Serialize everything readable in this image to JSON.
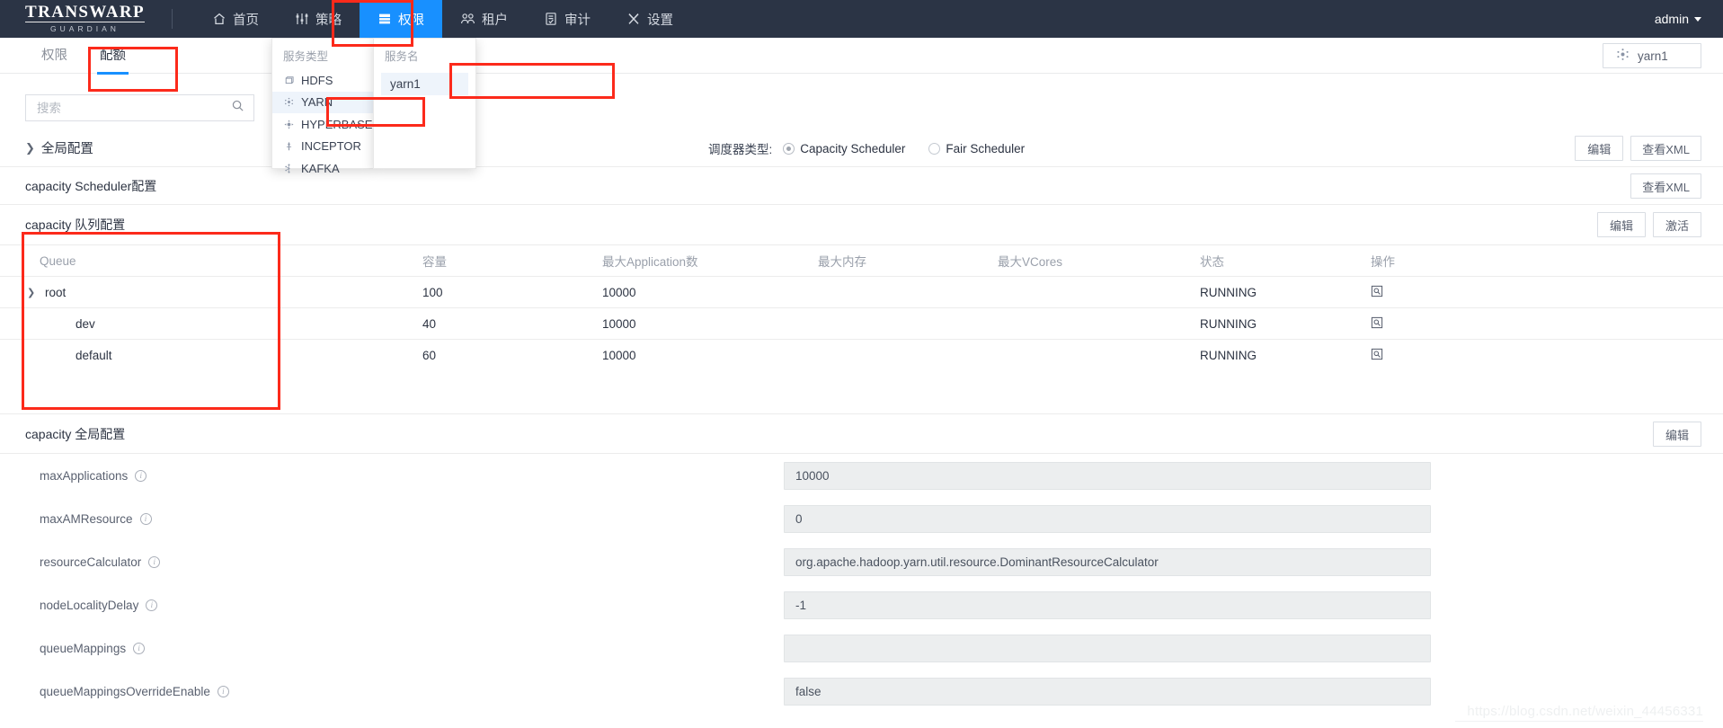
{
  "brand": {
    "main": "TRANSWARP",
    "sub": "GUARDIAN"
  },
  "navbar": {
    "items": [
      {
        "label": "首页",
        "icon": "home-icon",
        "active": false
      },
      {
        "label": "策略",
        "icon": "sliders-icon",
        "active": false
      },
      {
        "label": "权限",
        "icon": "permissions-icon",
        "active": true
      },
      {
        "label": "租户",
        "icon": "tenant-icon",
        "active": false
      },
      {
        "label": "审计",
        "icon": "audit-icon",
        "active": false
      },
      {
        "label": "设置",
        "icon": "gear-icon",
        "active": false
      }
    ],
    "user": "admin"
  },
  "service_dropdown": {
    "type_header": "服务类型",
    "name_header": "服务名",
    "types": [
      {
        "label": "HDFS",
        "icon": "hdfs-icon",
        "selected": false
      },
      {
        "label": "YARN",
        "icon": "yarn-icon",
        "selected": true
      },
      {
        "label": "HYPERBASE",
        "icon": "hyperbase-icon",
        "selected": false
      },
      {
        "label": "INCEPTOR",
        "icon": "inceptor-icon",
        "selected": false
      },
      {
        "label": "KAFKA",
        "icon": "kafka-icon",
        "selected": false
      }
    ],
    "names": [
      {
        "label": "yarn1",
        "selected": true
      }
    ]
  },
  "tabs": [
    {
      "label": "权限",
      "active": false
    },
    {
      "label": "配额",
      "active": true
    }
  ],
  "service_chip": {
    "label": "yarn1",
    "icon": "yarn-icon"
  },
  "search": {
    "placeholder": "搜索",
    "value": ""
  },
  "global_section": {
    "title": "全局配置",
    "scheduler_label": "调度器类型:",
    "scheduler_options": [
      {
        "label": "Capacity Scheduler",
        "selected": true
      },
      {
        "label": "Fair Scheduler",
        "selected": false
      }
    ],
    "edit_label": "编辑",
    "xml_label": "查看XML"
  },
  "scheduler_section": {
    "title": "capacity Scheduler配置",
    "xml_label": "查看XML"
  },
  "queue_section": {
    "title": "capacity 队列配置",
    "edit_label": "编辑",
    "activate_label": "激活",
    "columns": [
      "Queue",
      "容量",
      "最大Application数",
      "最大内存",
      "最大VCores",
      "状态",
      "操作"
    ],
    "rows": [
      {
        "queue": "root",
        "indent": 0,
        "expandable": true,
        "capacity": "100",
        "max_applications": "10000",
        "max_memory": "",
        "max_vcores": "",
        "status": "RUNNING",
        "action_icon": "view-detail-icon"
      },
      {
        "queue": "dev",
        "indent": 1,
        "expandable": false,
        "capacity": "40",
        "max_applications": "10000",
        "max_memory": "",
        "max_vcores": "",
        "status": "RUNNING",
        "action_icon": "view-detail-icon"
      },
      {
        "queue": "default",
        "indent": 1,
        "expandable": false,
        "capacity": "60",
        "max_applications": "10000",
        "max_memory": "",
        "max_vcores": "",
        "status": "RUNNING",
        "action_icon": "view-detail-icon"
      }
    ]
  },
  "capacity_global": {
    "title": "capacity 全局配置",
    "edit_label": "编辑",
    "fields": [
      {
        "label": "maxApplications",
        "value": "10000"
      },
      {
        "label": "maxAMResource",
        "value": "0"
      },
      {
        "label": "resourceCalculator",
        "value": "org.apache.hadoop.yarn.util.resource.DominantResourceCalculator"
      },
      {
        "label": "nodeLocalityDelay",
        "value": "-1"
      },
      {
        "label": "queueMappings",
        "value": ""
      },
      {
        "label": "queueMappingsOverrideEnable",
        "value": "false"
      }
    ]
  },
  "watermark": "https://blog.csdn.net/weixin_44456331",
  "colors": {
    "accent": "#1890ff",
    "navbar_bg": "#2b3445",
    "annotation": "#fc2a1b",
    "field_bg": "#eceeef"
  }
}
